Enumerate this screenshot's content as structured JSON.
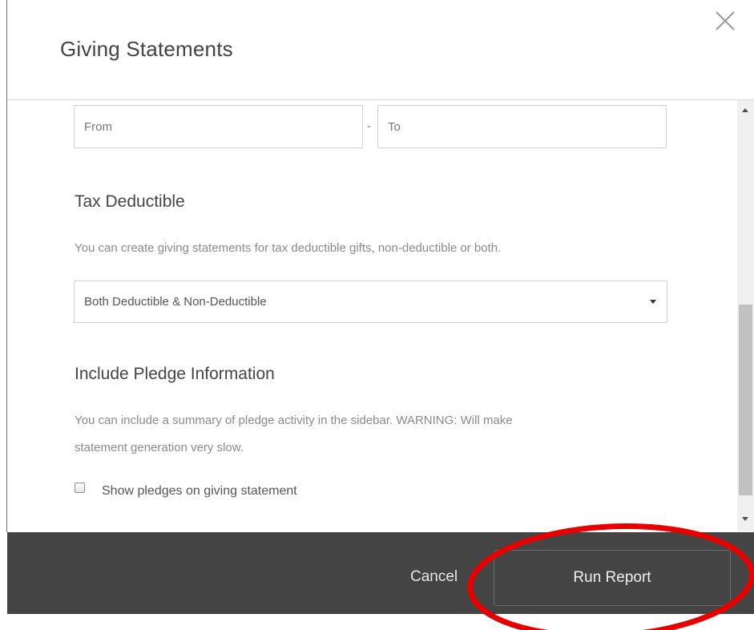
{
  "modal": {
    "title": "Giving Statements"
  },
  "date_range": {
    "from_placeholder": "From",
    "separator": "-",
    "to_placeholder": "To"
  },
  "tax_deductible": {
    "heading": "Tax Deductible",
    "description": "You can create giving statements for tax deductible gifts, non-deductible or both.",
    "selected": "Both Deductible & Non-Deductible"
  },
  "pledge": {
    "heading": "Include Pledge Information",
    "description_line1": "You can include a summary of pledge activity in the sidebar. WARNING: Will make",
    "description_line2": "statement generation very slow.",
    "checkbox_label": "Show pledges on giving statement",
    "checked": false
  },
  "footer": {
    "cancel_label": "Cancel",
    "run_label": "Run Report"
  },
  "colors": {
    "footer_bg": "#444444",
    "annotation": "#e60000"
  }
}
